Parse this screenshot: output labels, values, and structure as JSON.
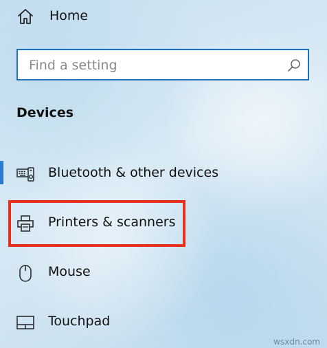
{
  "home": {
    "label": "Home",
    "icon": "home-icon"
  },
  "search": {
    "placeholder": "Find a setting",
    "icon": "search-icon",
    "border_color": "#1f6fbf"
  },
  "section": {
    "title": "Devices"
  },
  "nav": {
    "items": [
      {
        "label": "Bluetooth & other devices",
        "icon": "bluetooth-devices-icon",
        "selected": true
      },
      {
        "label": "Printers & scanners",
        "icon": "printer-icon",
        "selected": false,
        "highlighted": true
      },
      {
        "label": "Mouse",
        "icon": "mouse-icon",
        "selected": false
      },
      {
        "label": "Touchpad",
        "icon": "touchpad-icon",
        "selected": false
      }
    ]
  },
  "colors": {
    "accent": "#2a7bd1",
    "highlight": "#e8311b"
  },
  "watermark": "wsxdn.com"
}
